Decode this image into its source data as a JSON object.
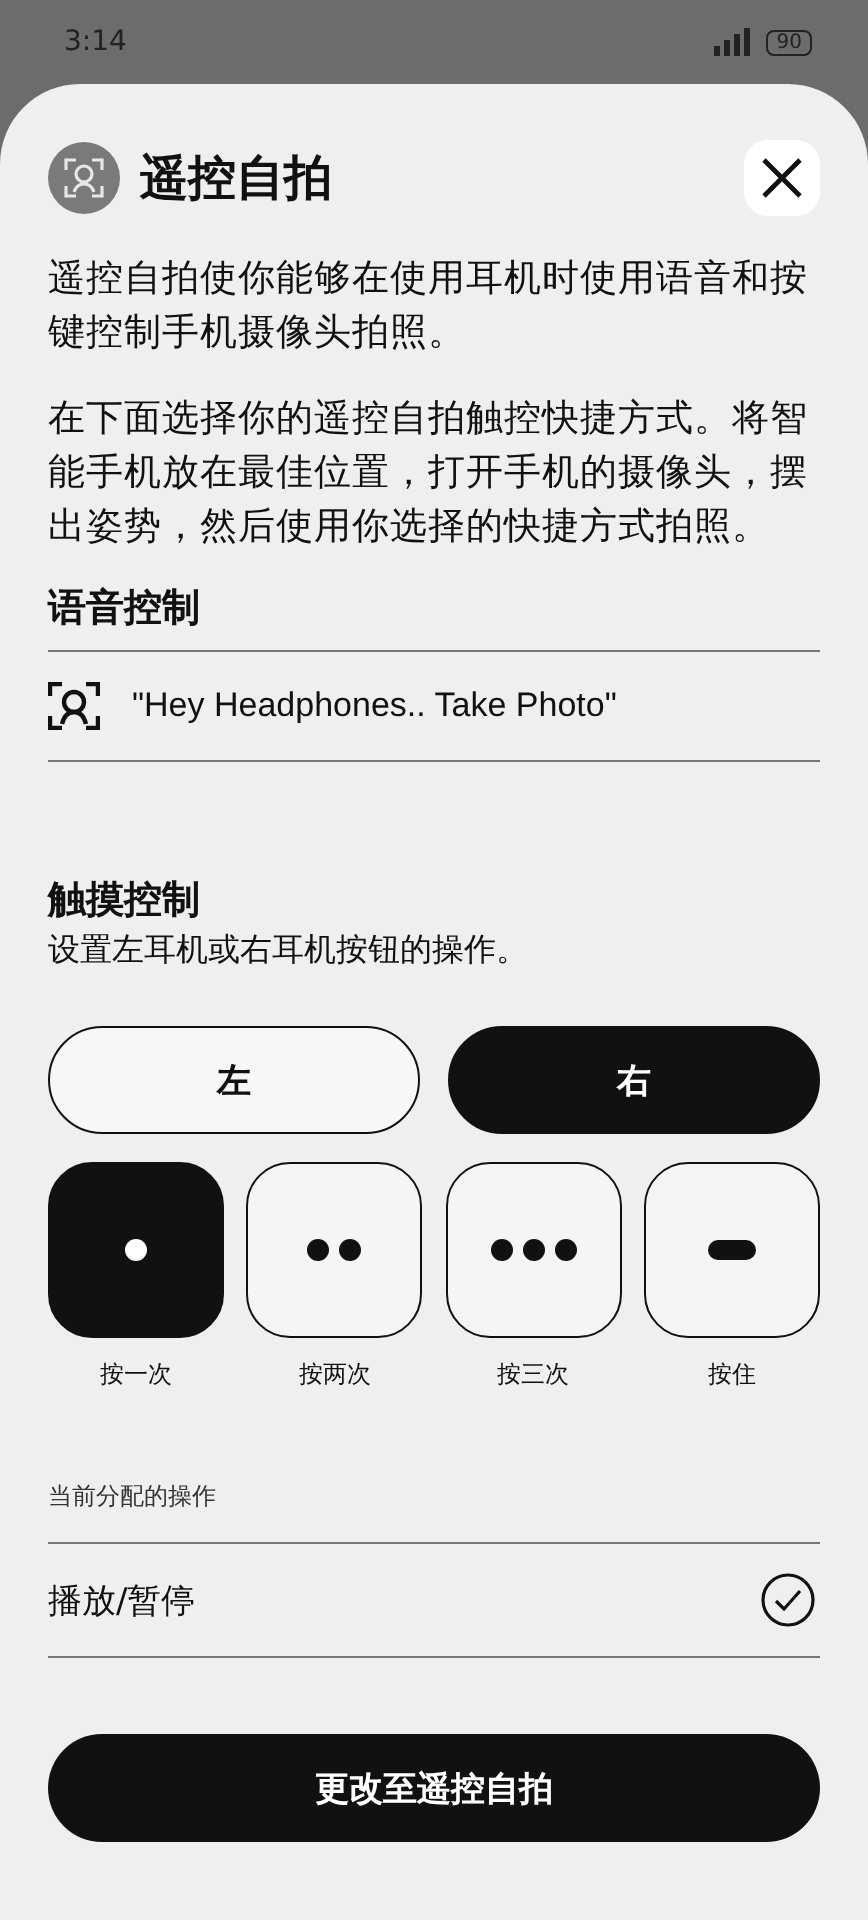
{
  "status_bar": {
    "time": "3:14",
    "battery": "90"
  },
  "title": "遥控自拍",
  "intro": [
    "遥控自拍使你能够在使用耳机时使用语音和按键控制手机摄像头拍照。",
    "在下面选择你的遥控自拍触控快捷方式。将智能手机放在最佳位置，打开手机的摄像头，摆出姿势，然后使用你选择的快捷方式拍照。"
  ],
  "voice": {
    "heading": "语音控制",
    "command": "\"Hey Headphones.. Take Photo\""
  },
  "touch": {
    "heading": "触摸控制",
    "subtitle": "设置左耳机或右耳机按钮的操作。"
  },
  "sides": [
    {
      "label": "左",
      "selected": false
    },
    {
      "label": "右",
      "selected": true
    }
  ],
  "gestures": [
    {
      "kind": "single",
      "label": "按一次",
      "selected": true
    },
    {
      "kind": "double",
      "label": "按两次",
      "selected": false
    },
    {
      "kind": "triple",
      "label": "按三次",
      "selected": false
    },
    {
      "kind": "hold",
      "label": "按住",
      "selected": false
    }
  ],
  "assigned": {
    "heading": "当前分配的操作",
    "action": "播放/暂停",
    "checked": true
  },
  "button": "更改至遥控自拍"
}
